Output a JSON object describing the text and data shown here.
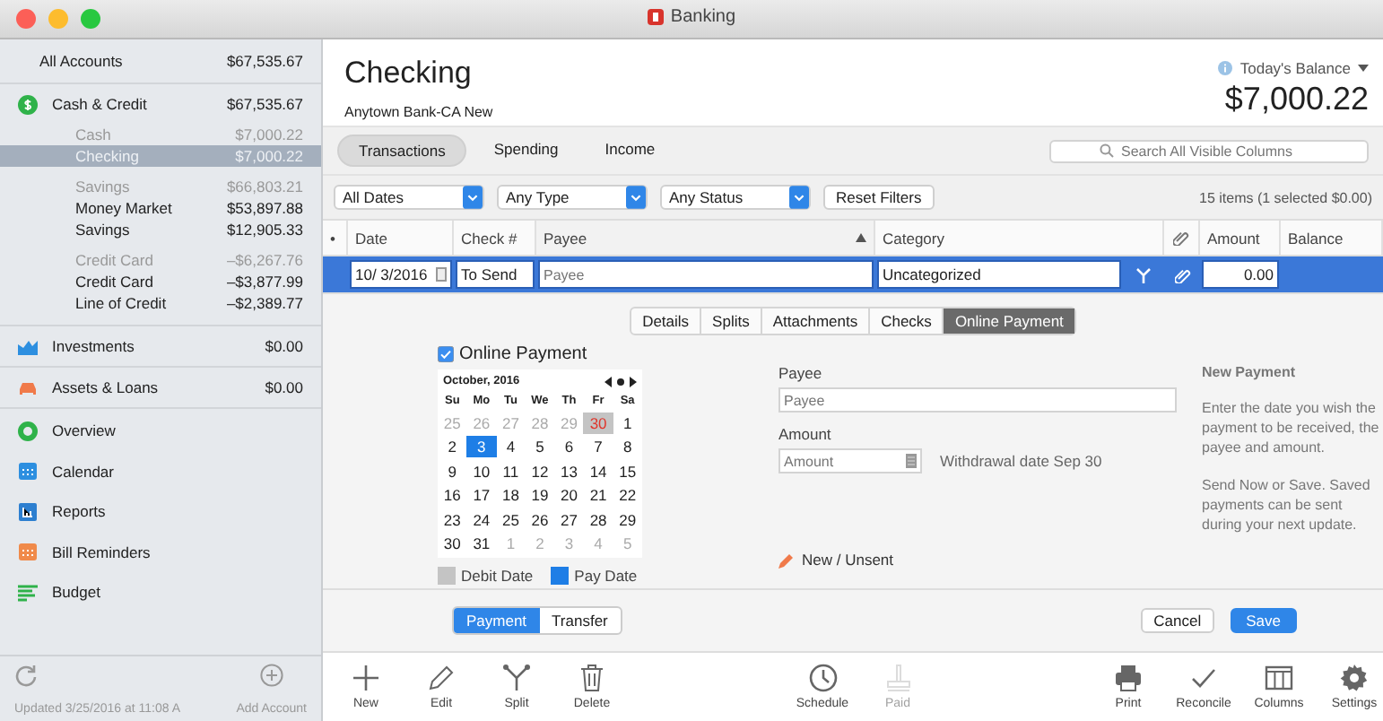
{
  "window": {
    "title": "Banking"
  },
  "sidebar": {
    "all_accounts": {
      "label": "All Accounts",
      "amount": "$67,535.67"
    },
    "cash_credit": {
      "label": "Cash & Credit",
      "amount": "$67,535.67",
      "groups": [
        {
          "label": "Cash",
          "amount": "$7,000.22",
          "accounts": [
            {
              "label": "Checking",
              "amount": "$7,000.22",
              "selected": true
            }
          ]
        },
        {
          "label": "Savings",
          "amount": "$66,803.21",
          "accounts": [
            {
              "label": "Money Market",
              "amount": "$53,897.88",
              "selected": false
            },
            {
              "label": "Savings",
              "amount": "$12,905.33",
              "selected": false
            }
          ]
        },
        {
          "label": "Credit Card",
          "amount": "–$6,267.76",
          "accounts": [
            {
              "label": "Credit Card",
              "amount": "–$3,877.99",
              "selected": false
            },
            {
              "label": "Line of Credit",
              "amount": "–$2,389.77",
              "selected": false
            }
          ]
        }
      ]
    },
    "sections": [
      {
        "label": "Investments",
        "amount": "$0.00",
        "selected": false
      },
      {
        "label": "Assets & Loans",
        "amount": "$0.00",
        "selected": false
      }
    ],
    "nav": [
      {
        "label": "Overview",
        "selected": false
      },
      {
        "label": "Calendar",
        "selected": false
      },
      {
        "label": "Reports",
        "selected": false
      },
      {
        "label": "Bill Reminders",
        "selected": false
      },
      {
        "label": "Budget",
        "selected": false
      }
    ],
    "footer": {
      "updated": "Updated 3/25/2016 at 11:08 A",
      "add_account": "Add Account"
    }
  },
  "header": {
    "title": "Checking",
    "subtitle": "Anytown Bank-CA New",
    "balance_label": "Today's Balance",
    "balance": "$7,000.22"
  },
  "view_tabs": [
    {
      "label": "Transactions",
      "selected": true
    },
    {
      "label": "Spending",
      "selected": false
    },
    {
      "label": "Income",
      "selected": false
    }
  ],
  "search": {
    "placeholder": "Search All Visible Columns"
  },
  "filters": [
    {
      "value": "All Dates"
    },
    {
      "value": "Any Type"
    },
    {
      "value": "Any Status"
    }
  ],
  "reset_filters": "Reset Filters",
  "item_count": "15 items (1 selected $0.00)",
  "table": {
    "columns": [
      {
        "label": "•",
        "sorted": false
      },
      {
        "label": "Date",
        "sorted": false
      },
      {
        "label": "Check #",
        "sorted": false
      },
      {
        "label": "Payee",
        "sorted": true
      },
      {
        "label": "Category",
        "sorted": false
      },
      {
        "label": "Amount",
        "sorted": false
      },
      {
        "label": "Balance",
        "sorted": false
      }
    ],
    "edit_row": {
      "date": "10/ 3/2016",
      "check": "To Send",
      "payee": {
        "placeholder": "Payee"
      },
      "category": "Uncategorized",
      "amount": "0.00"
    }
  },
  "detail": {
    "tabs": [
      {
        "label": "Details",
        "selected": false
      },
      {
        "label": "Splits",
        "selected": false
      },
      {
        "label": "Attachments",
        "selected": false
      },
      {
        "label": "Checks",
        "selected": false
      },
      {
        "label": "Online Payment",
        "selected": true
      }
    ],
    "online_payment": {
      "label": "Online Payment",
      "checked": true
    },
    "calendar": {
      "month": "October, 2016",
      "weekdays": [
        "Su",
        "Mo",
        "Tu",
        "We",
        "Th",
        "Fr",
        "Sa"
      ],
      "weeks": [
        [
          {
            "d": "25",
            "kind": "other"
          },
          {
            "d": "26",
            "kind": "other"
          },
          {
            "d": "27",
            "kind": "other"
          },
          {
            "d": "28",
            "kind": "other"
          },
          {
            "d": "29",
            "kind": "other"
          },
          {
            "d": "30",
            "kind": "debit"
          },
          {
            "d": "1",
            "kind": "day"
          }
        ],
        [
          {
            "d": "2",
            "kind": "day"
          },
          {
            "d": "3",
            "kind": "pay"
          },
          {
            "d": "4",
            "kind": "day"
          },
          {
            "d": "5",
            "kind": "day"
          },
          {
            "d": "6",
            "kind": "day"
          },
          {
            "d": "7",
            "kind": "day"
          },
          {
            "d": "8",
            "kind": "day"
          }
        ],
        [
          {
            "d": "9",
            "kind": "day"
          },
          {
            "d": "10",
            "kind": "day"
          },
          {
            "d": "11",
            "kind": "day"
          },
          {
            "d": "12",
            "kind": "day"
          },
          {
            "d": "13",
            "kind": "day"
          },
          {
            "d": "14",
            "kind": "day"
          },
          {
            "d": "15",
            "kind": "day"
          }
        ],
        [
          {
            "d": "16",
            "kind": "day"
          },
          {
            "d": "17",
            "kind": "day"
          },
          {
            "d": "18",
            "kind": "day"
          },
          {
            "d": "19",
            "kind": "day"
          },
          {
            "d": "20",
            "kind": "day"
          },
          {
            "d": "21",
            "kind": "day"
          },
          {
            "d": "22",
            "kind": "day"
          }
        ],
        [
          {
            "d": "23",
            "kind": "day"
          },
          {
            "d": "24",
            "kind": "day"
          },
          {
            "d": "25",
            "kind": "day"
          },
          {
            "d": "26",
            "kind": "day"
          },
          {
            "d": "27",
            "kind": "day"
          },
          {
            "d": "28",
            "kind": "day"
          },
          {
            "d": "29",
            "kind": "day"
          }
        ],
        [
          {
            "d": "30",
            "kind": "day"
          },
          {
            "d": "31",
            "kind": "day"
          },
          {
            "d": "1",
            "kind": "other"
          },
          {
            "d": "2",
            "kind": "other"
          },
          {
            "d": "3",
            "kind": "other"
          },
          {
            "d": "4",
            "kind": "other"
          },
          {
            "d": "5",
            "kind": "other"
          }
        ]
      ]
    },
    "legend": [
      {
        "label": "Debit Date",
        "color": "#c4c4c4"
      },
      {
        "label": "Pay Date",
        "color": "#1e7ee6"
      }
    ],
    "payee": {
      "label": "Payee",
      "placeholder": "Payee"
    },
    "amount": {
      "label": "Amount",
      "placeholder": "Amount"
    },
    "withdrawal": "Withdrawal date Sep 30",
    "status": "New / Unsent",
    "info": {
      "title": "New Payment",
      "paragraphs": [
        "Enter the date you wish the payment to be received, the payee and amount.",
        "Send Now or Save. Saved payments can be sent during your next update."
      ]
    },
    "modes": [
      {
        "label": "Payment",
        "selected": true
      },
      {
        "label": "Transfer",
        "selected": false
      }
    ],
    "cancel": "Cancel",
    "save": "Save"
  },
  "toolbar": {
    "left": [
      {
        "label": "New",
        "disabled": false
      },
      {
        "label": "Edit",
        "disabled": false
      },
      {
        "label": "Split",
        "disabled": false
      },
      {
        "label": "Delete",
        "disabled": false
      }
    ],
    "middle": [
      {
        "label": "Schedule",
        "disabled": false
      },
      {
        "label": "Paid",
        "disabled": true
      }
    ],
    "right": [
      {
        "label": "Print",
        "disabled": false
      },
      {
        "label": "Reconcile",
        "disabled": false
      },
      {
        "label": "Columns",
        "disabled": false
      },
      {
        "label": "Settings",
        "disabled": false
      }
    ]
  }
}
